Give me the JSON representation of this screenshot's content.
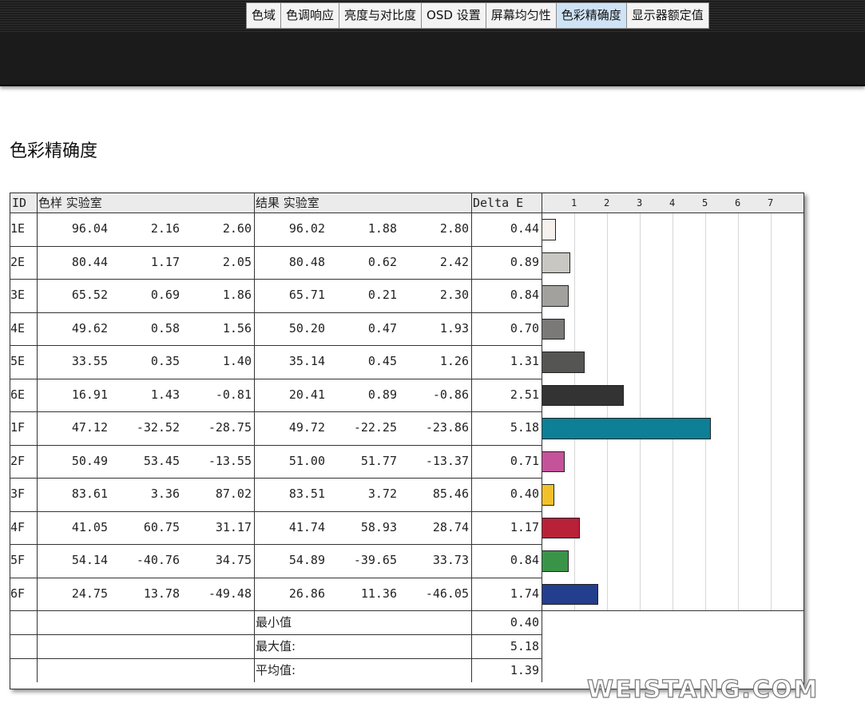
{
  "tabs": [
    {
      "label": "色域"
    },
    {
      "label": "色调响应"
    },
    {
      "label": "亮度与对比度"
    },
    {
      "label": "OSD 设置"
    },
    {
      "label": "屏幕均匀性"
    },
    {
      "label": "色彩精确度"
    },
    {
      "label": "显示器额定值"
    }
  ],
  "active_tab": "色彩精确度",
  "section_title": "色彩精确度",
  "table": {
    "headers": {
      "id": "ID",
      "sample": "色样 实验室",
      "result": "结果 实验室",
      "delta": "Delta E"
    },
    "axis_ticks": [
      "1",
      "2",
      "3",
      "4",
      "5",
      "6",
      "7"
    ],
    "rows": [
      {
        "id": "1E",
        "sample": [
          "96.04",
          "2.16",
          "2.60"
        ],
        "result": [
          "96.02",
          "1.88",
          "2.80"
        ],
        "delta": "0.44",
        "value": 0.44,
        "color": "#f6f1ec"
      },
      {
        "id": "2E",
        "sample": [
          "80.44",
          "1.17",
          "2.05"
        ],
        "result": [
          "80.48",
          "0.62",
          "2.42"
        ],
        "delta": "0.89",
        "value": 0.89,
        "color": "#c8c7c2"
      },
      {
        "id": "3E",
        "sample": [
          "65.52",
          "0.69",
          "1.86"
        ],
        "result": [
          "65.71",
          "0.21",
          "2.30"
        ],
        "delta": "0.84",
        "value": 0.84,
        "color": "#a2a19d"
      },
      {
        "id": "4E",
        "sample": [
          "49.62",
          "0.58",
          "1.56"
        ],
        "result": [
          "50.20",
          "0.47",
          "1.93"
        ],
        "delta": "0.70",
        "value": 0.7,
        "color": "#7a7977"
      },
      {
        "id": "5E",
        "sample": [
          "33.55",
          "0.35",
          "1.40"
        ],
        "result": [
          "35.14",
          "0.45",
          "1.26"
        ],
        "delta": "1.31",
        "value": 1.31,
        "color": "#555553"
      },
      {
        "id": "6E",
        "sample": [
          "16.91",
          "1.43",
          "-0.81"
        ],
        "result": [
          "20.41",
          "0.89",
          "-0.86"
        ],
        "delta": "2.51",
        "value": 2.51,
        "color": "#333333"
      },
      {
        "id": "1F",
        "sample": [
          "47.12",
          "-32.52",
          "-28.75"
        ],
        "result": [
          "49.72",
          "-22.25",
          "-23.86"
        ],
        "delta": "5.18",
        "value": 5.18,
        "color": "#0d7f96"
      },
      {
        "id": "2F",
        "sample": [
          "50.49",
          "53.45",
          "-13.55"
        ],
        "result": [
          "51.00",
          "51.77",
          "-13.37"
        ],
        "delta": "0.71",
        "value": 0.71,
        "color": "#c4539a"
      },
      {
        "id": "3F",
        "sample": [
          "83.61",
          "3.36",
          "87.02"
        ],
        "result": [
          "83.51",
          "3.72",
          "85.46"
        ],
        "delta": "0.40",
        "value": 0.4,
        "color": "#f2c12a"
      },
      {
        "id": "4F",
        "sample": [
          "41.05",
          "60.75",
          "31.17"
        ],
        "result": [
          "41.74",
          "58.93",
          "28.74"
        ],
        "delta": "1.17",
        "value": 1.17,
        "color": "#b82138"
      },
      {
        "id": "5F",
        "sample": [
          "54.14",
          "-40.76",
          "34.75"
        ],
        "result": [
          "54.89",
          "-39.65",
          "33.73"
        ],
        "delta": "0.84",
        "value": 0.84,
        "color": "#3a9448"
      },
      {
        "id": "6F",
        "sample": [
          "24.75",
          "13.78",
          "-49.48"
        ],
        "result": [
          "26.86",
          "11.36",
          "-46.05"
        ],
        "delta": "1.74",
        "value": 1.74,
        "color": "#233e8c"
      }
    ],
    "stats": [
      {
        "label": "最小值",
        "value": "0.40"
      },
      {
        "label": "最大值:",
        "value": "5.18"
      },
      {
        "label": "平均值:",
        "value": "1.39"
      }
    ]
  },
  "watermark": "WEISTANG.COM"
}
